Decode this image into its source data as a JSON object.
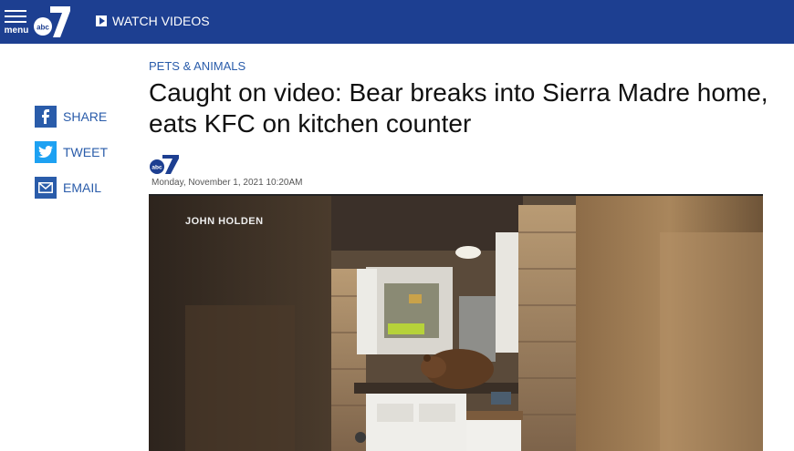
{
  "header": {
    "menu_label": "menu",
    "logo_text": "abc 7",
    "watch_videos": "WATCH VIDEOS",
    "brand_color": "#1d3f91"
  },
  "share": {
    "items": [
      {
        "label": "SHARE",
        "icon": "facebook-icon"
      },
      {
        "label": "TWEET",
        "icon": "twitter-icon"
      },
      {
        "label": "EMAIL",
        "icon": "email-icon"
      }
    ]
  },
  "article": {
    "category": "PETS & ANIMALS",
    "headline": "Caught on video: Bear breaks into Sierra Madre home, eats KFC on kitchen counter",
    "dateline": "Monday, November 1, 2021 10:20AM"
  },
  "video": {
    "credit": "JOHN HOLDEN"
  }
}
